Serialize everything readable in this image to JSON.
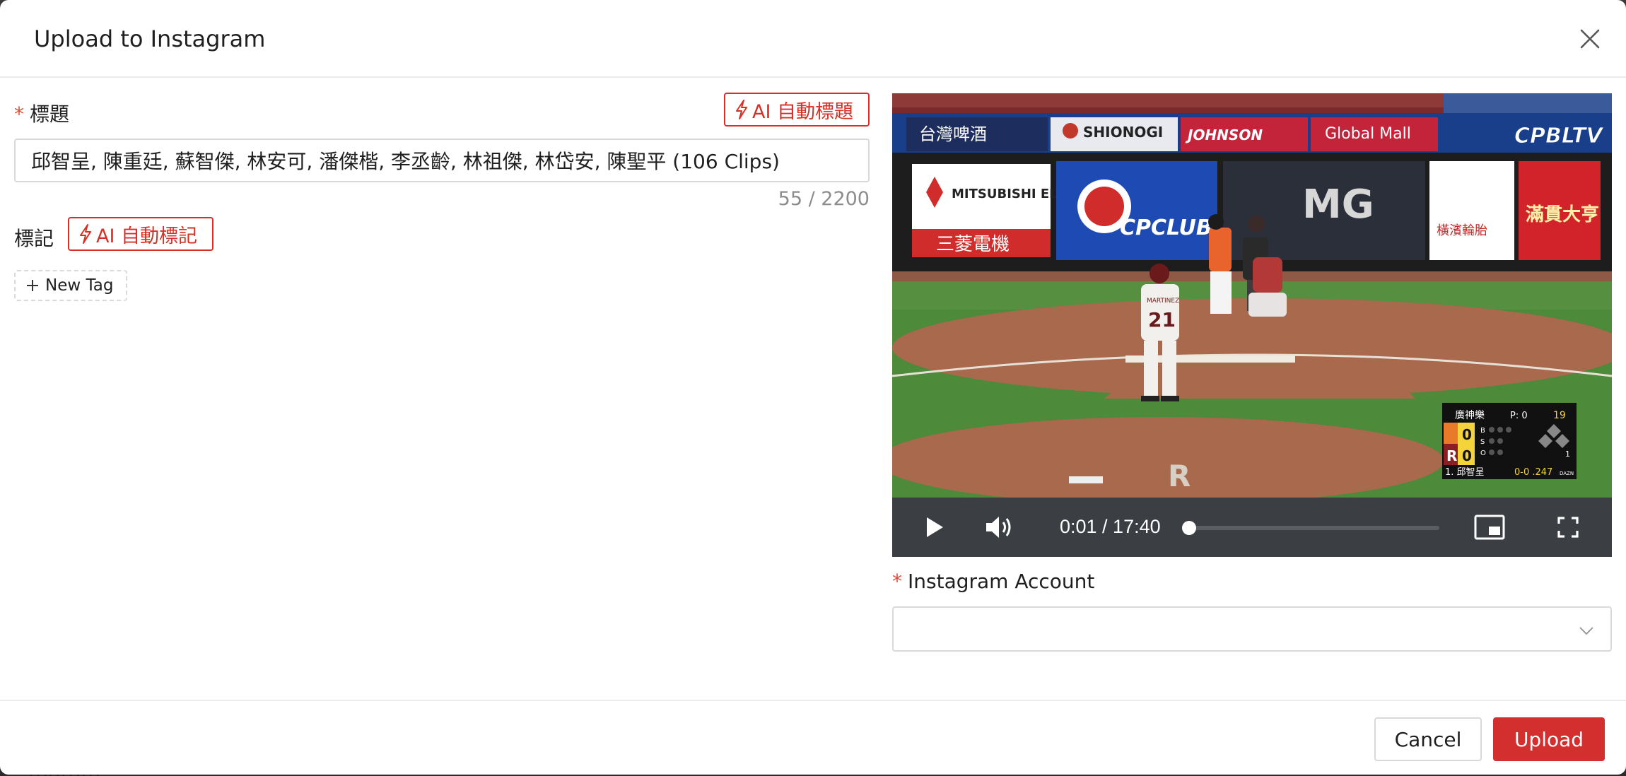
{
  "backdrop": {
    "partial_text": "tagram"
  },
  "modal": {
    "title": "Upload to Instagram"
  },
  "form": {
    "title_field": {
      "required_mark": "*",
      "label": "標題",
      "ai_button_label": "AI 自動標題",
      "value": "邱智呈, 陳重廷, 蘇智傑, 林安可, 潘傑楷, 李丞齡, 林祖傑, 林岱安, 陳聖平 (106 Clips)",
      "char_count": "55 / 2200"
    },
    "tags_field": {
      "label": "標記",
      "ai_button_label": "AI 自動標記",
      "new_tag_label": "New Tag"
    },
    "account_field": {
      "required_mark": "*",
      "label": "Instagram Account",
      "value": ""
    }
  },
  "video": {
    "time_display": "0:01 / 17:40",
    "progress": 0.001,
    "scoreboard": {
      "team_away": "廣神樂",
      "pitch_count": "P: 0",
      "pitch_speed": "19",
      "team_home_abbr": "R",
      "score_away": "0",
      "score_home": "0",
      "batter": "1. 邱智呈",
      "batter_line": "0-0 .247",
      "outs": "1",
      "broadcaster": "DAZN"
    },
    "ads": {
      "top_left": "台灣啤酒",
      "shionogi": "SHIONOGI",
      "johnson": "JOHNSON",
      "global_mall": "Global Mall",
      "channel": "CPBLTV",
      "mitsubishi": "MITSUBISHI ELECTRIC",
      "mitsubishi_cn": "三菱電機",
      "cpclub": "CPCLUB",
      "mg": "MG",
      "yokohama": "橫濱輪胎",
      "right": "滿貫大亨"
    },
    "pitcher_number": "21",
    "pitcher_name": "MARTINEZ"
  },
  "footer": {
    "cancel_label": "Cancel",
    "upload_label": "Upload"
  },
  "colors": {
    "accent": "#d32f2f",
    "required": "#e24a3b",
    "border": "#d9d9d9"
  }
}
